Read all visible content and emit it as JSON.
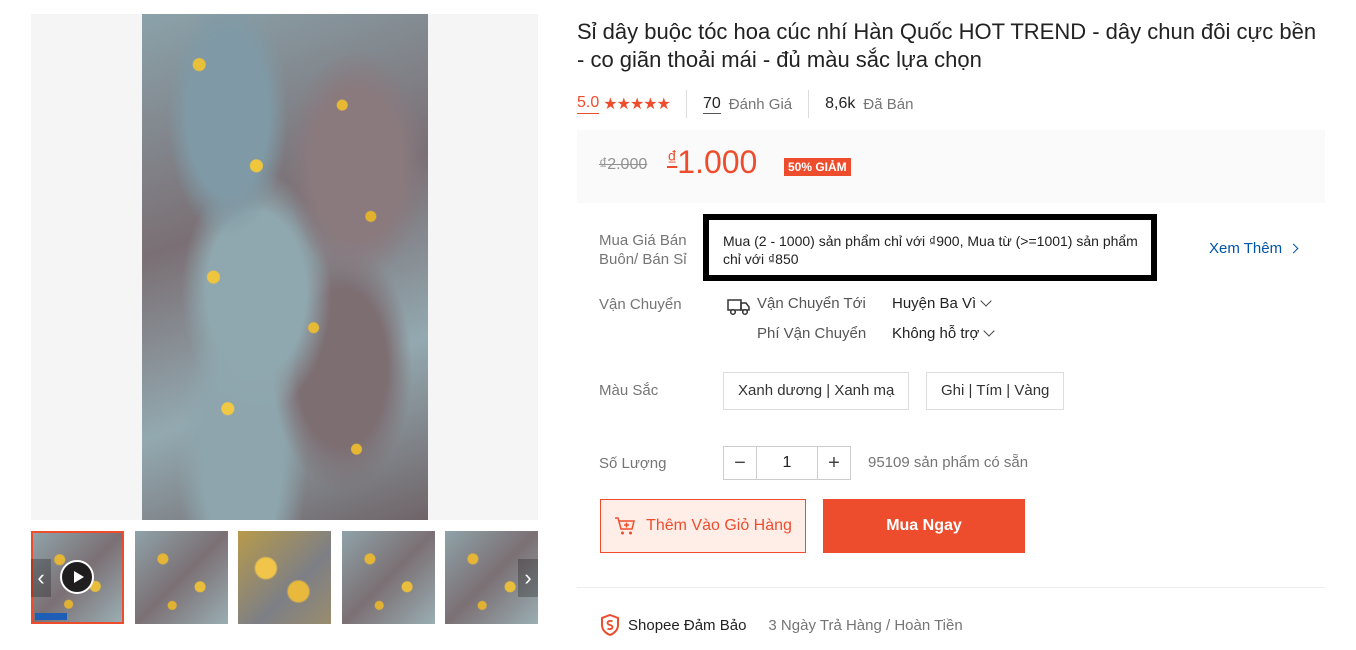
{
  "product": {
    "title": "Sỉ dây buộc tóc hoa cúc nhí Hàn Quốc HOT TREND - dây chun đôi cực bền - co giãn thoải mái - đủ màu sắc lựa chọn",
    "rating": "5.0",
    "stars": "★★★★★",
    "review_count": "70",
    "review_label": "Đánh Giá",
    "sold_count": "8,6k",
    "sold_label": "Đã Bán"
  },
  "price": {
    "old": "₫2.000",
    "currency": "₫",
    "current": "1.000",
    "discount": "50% GIẢM"
  },
  "wholesale": {
    "label": "Mua Giá Bán Buôn/ Bán Sỉ",
    "text": "Mua (2 - 1000) sản phẩm chỉ với ₫900, Mua từ (>=1001) sản phẩm chỉ với ₫850",
    "more": "Xem Thêm"
  },
  "shipping": {
    "label": "Vận Chuyển",
    "to_label": "Vận Chuyển Tới",
    "to_value": "Huyện Ba Vì",
    "fee_label": "Phí Vận Chuyển",
    "fee_value": "Không hỗ trợ"
  },
  "color": {
    "label": "Màu Sắc",
    "options": [
      "Xanh dương | Xanh mạ",
      "Ghi | Tím | Vàng"
    ]
  },
  "quantity": {
    "label": "Số Lượng",
    "minus": "−",
    "value": "1",
    "plus": "+",
    "stock": "95109 sản phẩm có sẵn"
  },
  "actions": {
    "add_to_cart": "Thêm Vào Giỏ Hàng",
    "buy_now": "Mua Ngay"
  },
  "guarantee": {
    "title": "Shopee Đảm Bảo",
    "text": "3 Ngày Trả Hàng / Hoàn Tiền"
  },
  "gallery": {
    "arrow_left": "‹",
    "arrow_right": "›"
  },
  "colors": {
    "accent": "#ee4d2d",
    "link": "#0055aa"
  }
}
